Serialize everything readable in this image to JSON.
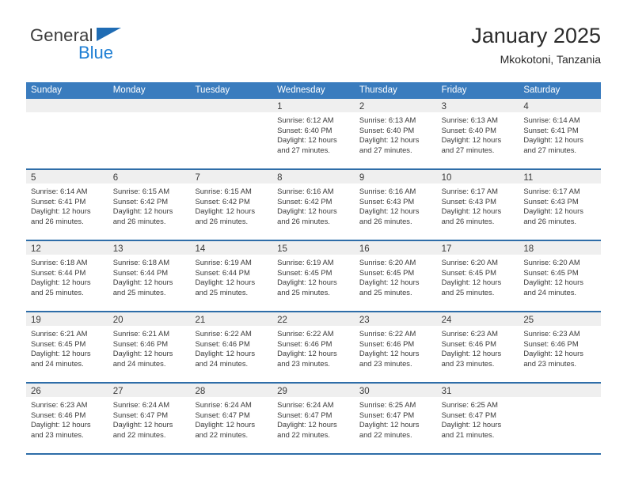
{
  "brand": {
    "name_part1": "General",
    "name_part2": "Blue",
    "triangle_color": "#1f6cb4",
    "blue_text_color": "#1f7fd4"
  },
  "header": {
    "title": "January 2025",
    "subtitle": "Mkokotoni, Tanzania"
  },
  "theme": {
    "header_row_bg": "#3a7cbe",
    "week_divider": "#2e6da8",
    "day_band_bg": "#efefef",
    "text": "#3a3a3a"
  },
  "weekday_headers": [
    "Sunday",
    "Monday",
    "Tuesday",
    "Wednesday",
    "Thursday",
    "Friday",
    "Saturday"
  ],
  "weeks": [
    [
      {
        "day": "",
        "empty": true,
        "sunrise": "",
        "sunset": "",
        "daylight_line1": "",
        "daylight_line2": ""
      },
      {
        "day": "",
        "empty": true,
        "sunrise": "",
        "sunset": "",
        "daylight_line1": "",
        "daylight_line2": ""
      },
      {
        "day": "",
        "empty": true,
        "sunrise": "",
        "sunset": "",
        "daylight_line1": "",
        "daylight_line2": ""
      },
      {
        "day": "1",
        "sunrise": "Sunrise: 6:12 AM",
        "sunset": "Sunset: 6:40 PM",
        "daylight_line1": "Daylight: 12 hours",
        "daylight_line2": "and 27 minutes."
      },
      {
        "day": "2",
        "sunrise": "Sunrise: 6:13 AM",
        "sunset": "Sunset: 6:40 PM",
        "daylight_line1": "Daylight: 12 hours",
        "daylight_line2": "and 27 minutes."
      },
      {
        "day": "3",
        "sunrise": "Sunrise: 6:13 AM",
        "sunset": "Sunset: 6:40 PM",
        "daylight_line1": "Daylight: 12 hours",
        "daylight_line2": "and 27 minutes."
      },
      {
        "day": "4",
        "sunrise": "Sunrise: 6:14 AM",
        "sunset": "Sunset: 6:41 PM",
        "daylight_line1": "Daylight: 12 hours",
        "daylight_line2": "and 27 minutes."
      }
    ],
    [
      {
        "day": "5",
        "sunrise": "Sunrise: 6:14 AM",
        "sunset": "Sunset: 6:41 PM",
        "daylight_line1": "Daylight: 12 hours",
        "daylight_line2": "and 26 minutes."
      },
      {
        "day": "6",
        "sunrise": "Sunrise: 6:15 AM",
        "sunset": "Sunset: 6:42 PM",
        "daylight_line1": "Daylight: 12 hours",
        "daylight_line2": "and 26 minutes."
      },
      {
        "day": "7",
        "sunrise": "Sunrise: 6:15 AM",
        "sunset": "Sunset: 6:42 PM",
        "daylight_line1": "Daylight: 12 hours",
        "daylight_line2": "and 26 minutes."
      },
      {
        "day": "8",
        "sunrise": "Sunrise: 6:16 AM",
        "sunset": "Sunset: 6:42 PM",
        "daylight_line1": "Daylight: 12 hours",
        "daylight_line2": "and 26 minutes."
      },
      {
        "day": "9",
        "sunrise": "Sunrise: 6:16 AM",
        "sunset": "Sunset: 6:43 PM",
        "daylight_line1": "Daylight: 12 hours",
        "daylight_line2": "and 26 minutes."
      },
      {
        "day": "10",
        "sunrise": "Sunrise: 6:17 AM",
        "sunset": "Sunset: 6:43 PM",
        "daylight_line1": "Daylight: 12 hours",
        "daylight_line2": "and 26 minutes."
      },
      {
        "day": "11",
        "sunrise": "Sunrise: 6:17 AM",
        "sunset": "Sunset: 6:43 PM",
        "daylight_line1": "Daylight: 12 hours",
        "daylight_line2": "and 26 minutes."
      }
    ],
    [
      {
        "day": "12",
        "sunrise": "Sunrise: 6:18 AM",
        "sunset": "Sunset: 6:44 PM",
        "daylight_line1": "Daylight: 12 hours",
        "daylight_line2": "and 25 minutes."
      },
      {
        "day": "13",
        "sunrise": "Sunrise: 6:18 AM",
        "sunset": "Sunset: 6:44 PM",
        "daylight_line1": "Daylight: 12 hours",
        "daylight_line2": "and 25 minutes."
      },
      {
        "day": "14",
        "sunrise": "Sunrise: 6:19 AM",
        "sunset": "Sunset: 6:44 PM",
        "daylight_line1": "Daylight: 12 hours",
        "daylight_line2": "and 25 minutes."
      },
      {
        "day": "15",
        "sunrise": "Sunrise: 6:19 AM",
        "sunset": "Sunset: 6:45 PM",
        "daylight_line1": "Daylight: 12 hours",
        "daylight_line2": "and 25 minutes."
      },
      {
        "day": "16",
        "sunrise": "Sunrise: 6:20 AM",
        "sunset": "Sunset: 6:45 PM",
        "daylight_line1": "Daylight: 12 hours",
        "daylight_line2": "and 25 minutes."
      },
      {
        "day": "17",
        "sunrise": "Sunrise: 6:20 AM",
        "sunset": "Sunset: 6:45 PM",
        "daylight_line1": "Daylight: 12 hours",
        "daylight_line2": "and 25 minutes."
      },
      {
        "day": "18",
        "sunrise": "Sunrise: 6:20 AM",
        "sunset": "Sunset: 6:45 PM",
        "daylight_line1": "Daylight: 12 hours",
        "daylight_line2": "and 24 minutes."
      }
    ],
    [
      {
        "day": "19",
        "sunrise": "Sunrise: 6:21 AM",
        "sunset": "Sunset: 6:45 PM",
        "daylight_line1": "Daylight: 12 hours",
        "daylight_line2": "and 24 minutes."
      },
      {
        "day": "20",
        "sunrise": "Sunrise: 6:21 AM",
        "sunset": "Sunset: 6:46 PM",
        "daylight_line1": "Daylight: 12 hours",
        "daylight_line2": "and 24 minutes."
      },
      {
        "day": "21",
        "sunrise": "Sunrise: 6:22 AM",
        "sunset": "Sunset: 6:46 PM",
        "daylight_line1": "Daylight: 12 hours",
        "daylight_line2": "and 24 minutes."
      },
      {
        "day": "22",
        "sunrise": "Sunrise: 6:22 AM",
        "sunset": "Sunset: 6:46 PM",
        "daylight_line1": "Daylight: 12 hours",
        "daylight_line2": "and 23 minutes."
      },
      {
        "day": "23",
        "sunrise": "Sunrise: 6:22 AM",
        "sunset": "Sunset: 6:46 PM",
        "daylight_line1": "Daylight: 12 hours",
        "daylight_line2": "and 23 minutes."
      },
      {
        "day": "24",
        "sunrise": "Sunrise: 6:23 AM",
        "sunset": "Sunset: 6:46 PM",
        "daylight_line1": "Daylight: 12 hours",
        "daylight_line2": "and 23 minutes."
      },
      {
        "day": "25",
        "sunrise": "Sunrise: 6:23 AM",
        "sunset": "Sunset: 6:46 PM",
        "daylight_line1": "Daylight: 12 hours",
        "daylight_line2": "and 23 minutes."
      }
    ],
    [
      {
        "day": "26",
        "sunrise": "Sunrise: 6:23 AM",
        "sunset": "Sunset: 6:46 PM",
        "daylight_line1": "Daylight: 12 hours",
        "daylight_line2": "and 23 minutes."
      },
      {
        "day": "27",
        "sunrise": "Sunrise: 6:24 AM",
        "sunset": "Sunset: 6:47 PM",
        "daylight_line1": "Daylight: 12 hours",
        "daylight_line2": "and 22 minutes."
      },
      {
        "day": "28",
        "sunrise": "Sunrise: 6:24 AM",
        "sunset": "Sunset: 6:47 PM",
        "daylight_line1": "Daylight: 12 hours",
        "daylight_line2": "and 22 minutes."
      },
      {
        "day": "29",
        "sunrise": "Sunrise: 6:24 AM",
        "sunset": "Sunset: 6:47 PM",
        "daylight_line1": "Daylight: 12 hours",
        "daylight_line2": "and 22 minutes."
      },
      {
        "day": "30",
        "sunrise": "Sunrise: 6:25 AM",
        "sunset": "Sunset: 6:47 PM",
        "daylight_line1": "Daylight: 12 hours",
        "daylight_line2": "and 22 minutes."
      },
      {
        "day": "31",
        "sunrise": "Sunrise: 6:25 AM",
        "sunset": "Sunset: 6:47 PM",
        "daylight_line1": "Daylight: 12 hours",
        "daylight_line2": "and 21 minutes."
      },
      {
        "day": "",
        "empty": true,
        "sunrise": "",
        "sunset": "",
        "daylight_line1": "",
        "daylight_line2": ""
      }
    ]
  ]
}
